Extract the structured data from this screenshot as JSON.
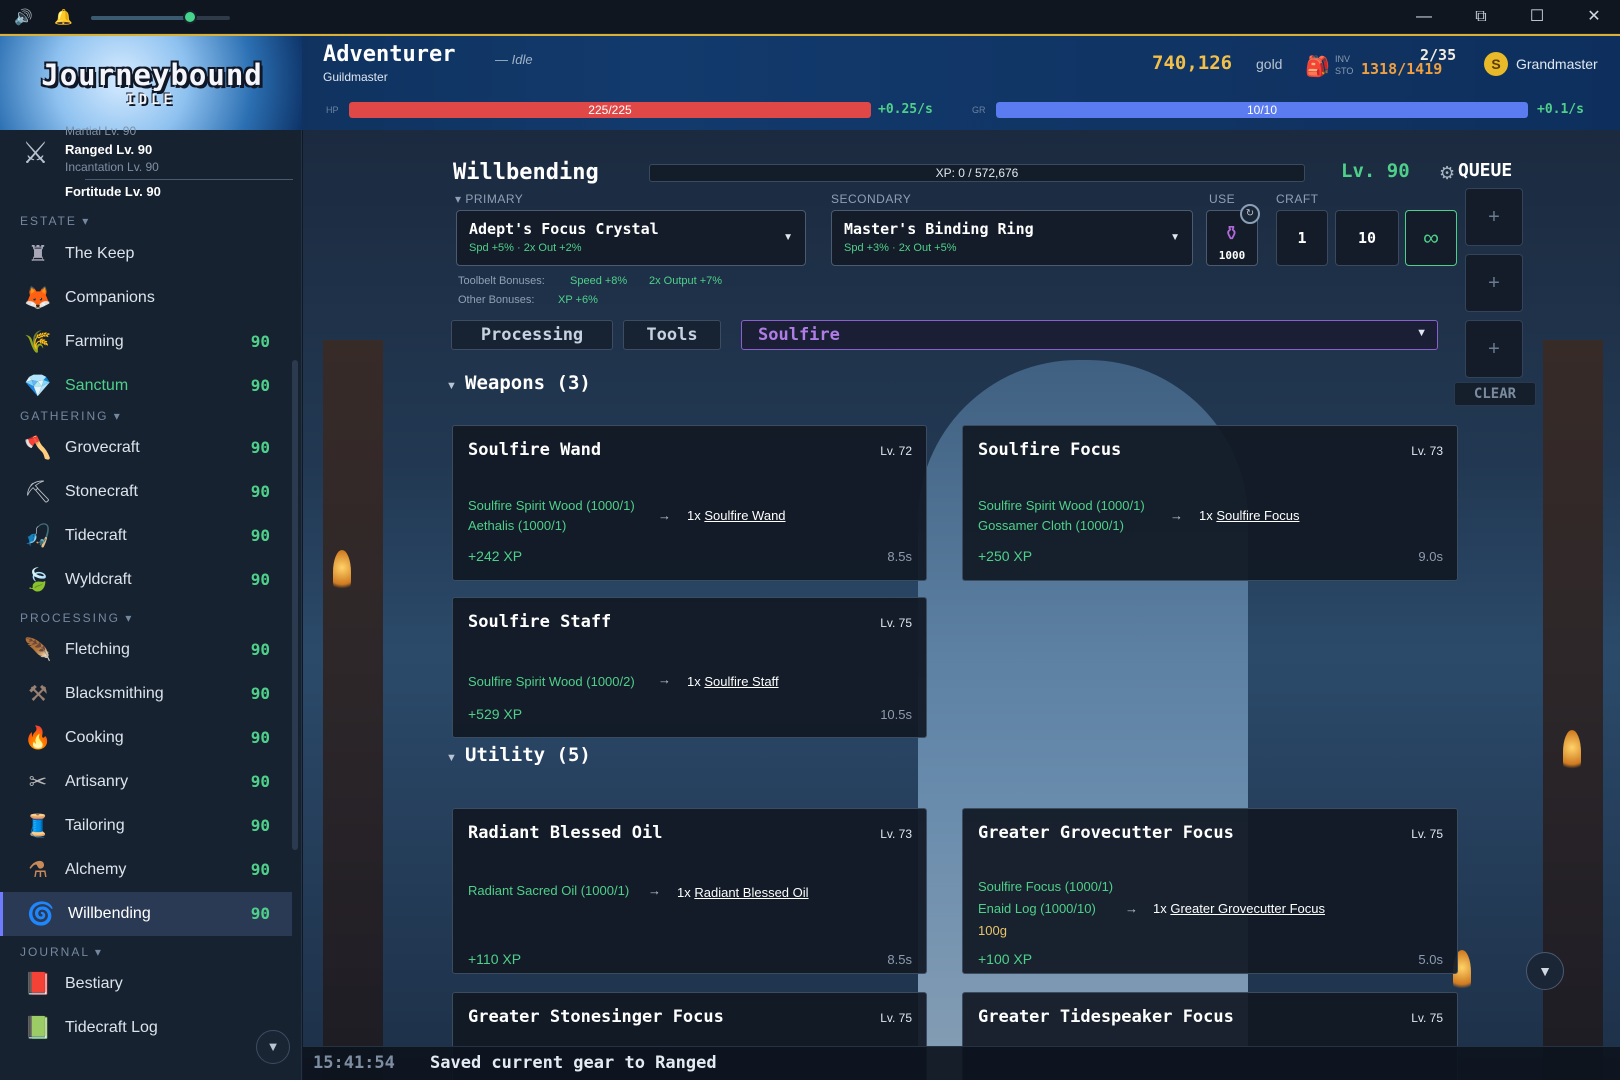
{
  "window": {
    "minimize": "—",
    "restore": "⧉",
    "maximize": "☐",
    "close": "✕"
  },
  "topbar": {
    "volume_icon": "speaker-icon",
    "bell_icon": "bell-icon",
    "volume_level": 0.72
  },
  "logo": {
    "title": "Journeybound",
    "subtitle": "IDLE"
  },
  "character": {
    "name": "Adventurer",
    "status": "— Idle",
    "title": "Guildmaster",
    "gold_value": "740,126",
    "gold_label": "gold",
    "inv_label": "INV",
    "sto_label": "STO",
    "inv_count": "2/35",
    "sto_count": "1318/1419",
    "rank_symbol": "S",
    "rank": "Grandmaster",
    "hp_label": "HP",
    "hp_text": "225/225",
    "hp_fraction": 1.0,
    "hp_rate": "+0.25/s",
    "gr_label": "GR",
    "gr_text": "10/10",
    "gr_fraction": 1.0,
    "gr_rate": "+0.1/s"
  },
  "colors": {
    "accent_green": "#4fd08a",
    "gold": "#f2c04a",
    "hp_red": "#e04848",
    "gr_blue": "#5b7cf0",
    "category_purple": "#b07de6"
  },
  "sidebar": {
    "loadout": {
      "martial": "Martial Lv. 90",
      "ranged": "Ranged Lv. 90",
      "incantation": "Incantation Lv. 90",
      "fortitude": "Fortitude Lv. 90"
    },
    "sections": {
      "estate": "ESTATE ▾",
      "gathering": "GATHERING ▾",
      "processing": "PROCESSING ▾",
      "journal": "JOURNAL ▾"
    },
    "estate": [
      {
        "label": "The Keep",
        "level": ""
      },
      {
        "label": "Companions",
        "level": ""
      },
      {
        "label": "Farming",
        "level": "90"
      },
      {
        "label": "Sanctum",
        "level": "90"
      }
    ],
    "gathering": [
      {
        "label": "Grovecraft",
        "level": "90"
      },
      {
        "label": "Stonecraft",
        "level": "90"
      },
      {
        "label": "Tidecraft",
        "level": "90"
      },
      {
        "label": "Wyldcraft",
        "level": "90"
      }
    ],
    "processing": [
      {
        "label": "Fletching",
        "level": "90"
      },
      {
        "label": "Blacksmithing",
        "level": "90"
      },
      {
        "label": "Cooking",
        "level": "90"
      },
      {
        "label": "Artisanry",
        "level": "90"
      },
      {
        "label": "Tailoring",
        "level": "90"
      },
      {
        "label": "Alchemy",
        "level": "90"
      },
      {
        "label": "Willbending",
        "level": "90"
      }
    ],
    "journal": [
      {
        "label": "Bestiary",
        "level": ""
      },
      {
        "label": "Tidecraft Log",
        "level": ""
      }
    ]
  },
  "skill": {
    "name": "Willbending",
    "xp_text": "XP: 0 / 572,676",
    "level": "Lv. 90",
    "primary_label": "▾ PRIMARY",
    "secondary_label": "SECONDARY",
    "use_label": "USE",
    "craft_label": "CRAFT",
    "primary_name": "Adept's Focus Crystal",
    "primary_stats": "Spd +5% · 2x Out +2%",
    "secondary_name": "Master's Binding Ring",
    "secondary_stats": "Spd +3% · 2x Out +5%",
    "use_count": "1000",
    "craft_1": "1",
    "craft_10": "10",
    "craft_inf": "∞",
    "toolbelt_label": "Toolbelt Bonuses:",
    "toolbelt_speed": "Speed +8%",
    "toolbelt_output": "2x Output +7%",
    "other_label": "Other Bonuses:",
    "other_xp": "XP +6%"
  },
  "tabs": {
    "processing": "Processing",
    "tools": "Tools",
    "category": "Soulfire"
  },
  "groups": {
    "weapons": "Weapons (3)",
    "utility": "Utility (5)"
  },
  "recipes": {
    "wand": {
      "name": "Soulfire Wand",
      "lv": "Lv. 72",
      "in1": "Soulfire Spirit Wood (1000/1)",
      "in2": "Aethalis (1000/1)",
      "qty": "1x",
      "out": "Soulfire Wand",
      "xp": "+242 XP",
      "time": "8.5s"
    },
    "focus": {
      "name": "Soulfire Focus",
      "lv": "Lv. 73",
      "in1": "Soulfire Spirit Wood (1000/1)",
      "in2": "Gossamer Cloth (1000/1)",
      "qty": "1x",
      "out": "Soulfire Focus",
      "xp": "+250 XP",
      "time": "9.0s"
    },
    "staff": {
      "name": "Soulfire Staff",
      "lv": "Lv. 75",
      "in1": "Soulfire Spirit Wood (1000/2)",
      "qty": "1x",
      "out": "Soulfire Staff",
      "xp": "+529 XP",
      "time": "10.5s"
    },
    "oil": {
      "name": "Radiant Blessed Oil",
      "lv": "Lv. 73",
      "in1": "Radiant Sacred Oil (1000/1)",
      "qty": "1x",
      "out": "Radiant Blessed Oil",
      "xp": "+110 XP",
      "time": "8.5s"
    },
    "grovecutter": {
      "name": "Greater Grovecutter Focus",
      "lv": "Lv. 75",
      "in1": "Soulfire Focus (1000/1)",
      "in2": "Enaid Log (1000/10)",
      "in3": "100g",
      "qty": "1x",
      "out": "Greater Grovecutter Focus",
      "xp": "+100 XP",
      "time": "5.0s"
    },
    "stonesinger": {
      "name": "Greater Stonesinger Focus",
      "lv": "Lv. 75"
    },
    "tidespeaker": {
      "name": "Greater Tidespeaker Focus",
      "lv": "Lv. 75"
    }
  },
  "queue": {
    "title": "QUEUE",
    "slot": "+",
    "clear": "CLEAR"
  },
  "log": {
    "time": "15:41:54",
    "message": "Saved current gear to Ranged"
  }
}
